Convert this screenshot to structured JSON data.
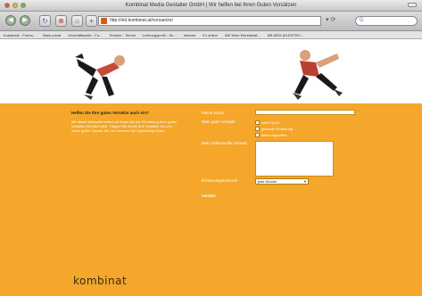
{
  "window": {
    "title": "Kombinat Media Gestalter GmbH | Wir helfen bei Ihren Guten Vorsätzen"
  },
  "toolbar": {
    "url": "http://old.kombinat.at/vorsaetze/",
    "search_icon": "G"
  },
  "bookmarks": [
    "Kokabank - Formu...",
    "Bank privat",
    "Geschäftsseite - Fa...",
    "Termine - Termin",
    "Leistungsprofil - Se...",
    "Intranet",
    "K1 online",
    "WK Wien Einreibealt...",
    "BB-WEB (ELEKTRO..."
  ],
  "form": {
    "heading": "Helfen Sie Ihre guten Vorsätze auch ein?",
    "body": "Mit dieser Webseite helfen wir Ihnen bei der Einhaltung Ihrer guten Vorsätze beruflich sein. Tragen Sie rechts Ihre Vorsätze ein und Ihnen guten Vorsatz ein, wir erinnern Sie regelmäßig daran.",
    "email_label": "Meine Email",
    "vorsatz_label": "Mein guter Vorsatz",
    "options": [
      "mehr Sport",
      "gesunde Ernährung",
      "keine Zigaretten"
    ],
    "individual_label": "Mein individueller Vorsatz",
    "reminder_label": "Erinnerungsintervall",
    "reminder_value": "jede Woche",
    "submit": "senden"
  },
  "logo": "kombinat"
}
